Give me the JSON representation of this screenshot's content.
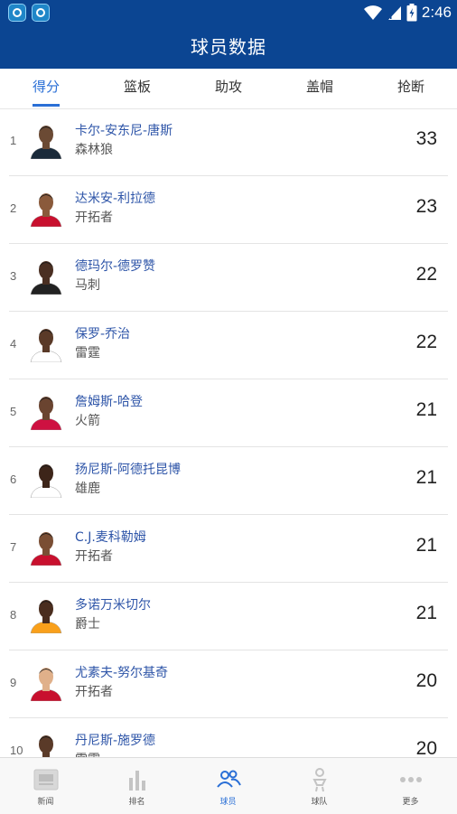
{
  "status_bar": {
    "time": "2:46"
  },
  "header": {
    "title": "球员数据"
  },
  "tabs": [
    {
      "label": "得分",
      "active": true
    },
    {
      "label": "篮板",
      "active": false
    },
    {
      "label": "助攻",
      "active": false
    },
    {
      "label": "盖帽",
      "active": false
    },
    {
      "label": "抢断",
      "active": false
    }
  ],
  "players": [
    {
      "rank": "1",
      "name": "卡尔-安东尼-唐斯",
      "team": "森林狼",
      "value": "33",
      "jersey": "#1a2a3a",
      "skin": "#6b4a34"
    },
    {
      "rank": "2",
      "name": "达米安-利拉德",
      "team": "开拓者",
      "value": "23",
      "jersey": "#c8102e",
      "skin": "#8a5a3b"
    },
    {
      "rank": "3",
      "name": "德玛尔-德罗赞",
      "team": "马刺",
      "value": "22",
      "jersey": "#222222",
      "skin": "#4a2f22"
    },
    {
      "rank": "4",
      "name": "保罗-乔治",
      "team": "雷霆",
      "value": "22",
      "jersey": "#ffffff",
      "skin": "#5a3a28"
    },
    {
      "rank": "5",
      "name": "詹姆斯-哈登",
      "team": "火箭",
      "value": "21",
      "jersey": "#ce1141",
      "skin": "#6a4430"
    },
    {
      "rank": "6",
      "name": "扬尼斯-阿德托昆博",
      "team": "雄鹿",
      "value": "21",
      "jersey": "#ffffff",
      "skin": "#3d2519"
    },
    {
      "rank": "7",
      "name": "C.J.麦科勒姆",
      "team": "开拓者",
      "value": "21",
      "jersey": "#c8102e",
      "skin": "#7a4e34"
    },
    {
      "rank": "8",
      "name": "多诺万米切尔",
      "team": "爵士",
      "value": "21",
      "jersey": "#f9a01b",
      "skin": "#4a2d1e"
    },
    {
      "rank": "9",
      "name": "尤素夫-努尔基奇",
      "team": "开拓者",
      "value": "20",
      "jersey": "#c8102e",
      "skin": "#e0b08a"
    },
    {
      "rank": "10",
      "name": "丹尼斯-施罗德",
      "team": "雷霆",
      "value": "20",
      "jersey": "#ffffff",
      "skin": "#5a3a28"
    }
  ],
  "bottom_nav": [
    {
      "label": "新闻",
      "icon": "news-icon",
      "active": false
    },
    {
      "label": "排名",
      "icon": "ranking-icon",
      "active": false
    },
    {
      "label": "球员",
      "icon": "players-icon",
      "active": true
    },
    {
      "label": "球队",
      "icon": "team-icon",
      "active": false
    },
    {
      "label": "更多",
      "icon": "more-icon",
      "active": false
    }
  ],
  "colors": {
    "brand": "#0b4592",
    "accent": "#2a6fd6"
  }
}
